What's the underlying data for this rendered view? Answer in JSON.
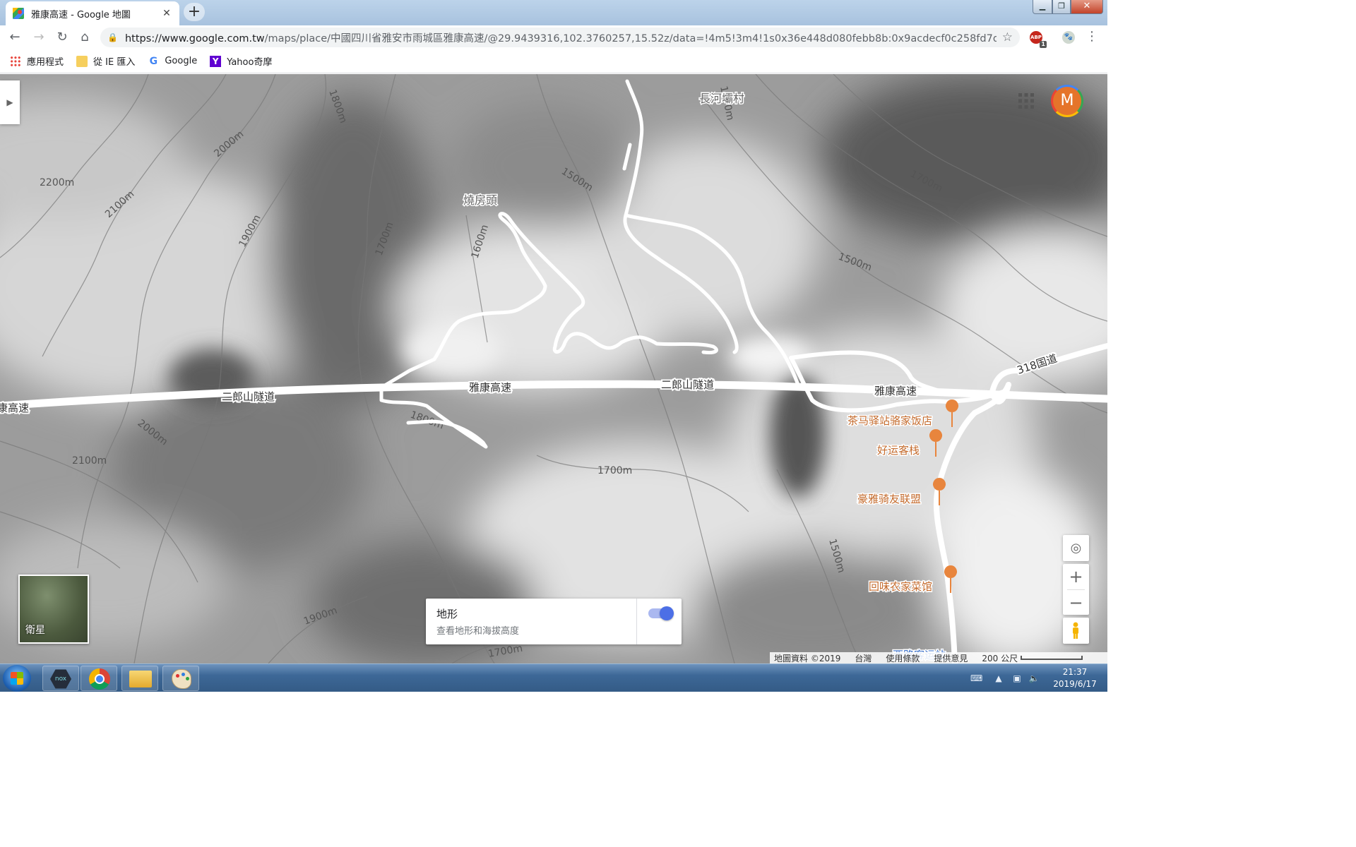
{
  "tab": {
    "title": "雅康高速 - Google 地圖",
    "close": "✕",
    "new_tab": "+"
  },
  "window_controls": {
    "minimize": "▁",
    "maximize": "❐",
    "close": "✕"
  },
  "toolbar": {
    "back": "←",
    "forward": "→",
    "reload": "↻",
    "home": "⌂",
    "url_domain": "https://www.google.com.tw",
    "url_path": "/maps/place/中國四川省雅安市雨城區雅康高速/@29.9439316,102.3760257,15.52z/data=!4m5!3m4!1s0x36e448d080febb8b:0x9acdecf0c258fd7d!8m2!3d2...",
    "abp_label": "ABP",
    "abp_count": "1",
    "menu": "⋮"
  },
  "bookmarks": [
    {
      "label": "應用程式",
      "icon": "apps-grid-icon"
    },
    {
      "label": "從 IE 匯入",
      "icon": "folder-icon"
    },
    {
      "label": "Google",
      "icon": "google-g-icon"
    },
    {
      "label": "Yahoo奇摩",
      "icon": "yahoo-y-icon"
    }
  ],
  "map": {
    "contour_labels": [
      "1800m",
      "2000m",
      "2200m",
      "2100m",
      "1900m",
      "1700m",
      "1600m",
      "1500m",
      "1600m",
      "1700m",
      "1500m",
      "2000m",
      "2100m",
      "1800m",
      "1700m",
      "1500m",
      "1900m",
      "1700m"
    ],
    "road_labels": [
      "康高速",
      "二郎山隧道",
      "雅康高速",
      "二郎山隧道",
      "雅康高速",
      "318国道"
    ],
    "place_labels": [
      "長河壩村",
      "燒房頭"
    ],
    "pois": [
      "茶马驿站骆家饭店",
      "好运客栈",
      "豪雅骑友联盟",
      "回味农家菜馆",
      "西路客运站"
    ]
  },
  "controls": {
    "side_toggle": "▶",
    "avatar_letter": "M",
    "satellite_label": "衛星",
    "terrain_title": "地形",
    "terrain_desc": "查看地形和海拔高度",
    "terrain_on": true,
    "locate": "◎",
    "zoom_in": "+",
    "zoom_out": "−"
  },
  "attribution": {
    "data": "地圖資料 ©2019",
    "region": "台灣",
    "terms": "使用條款",
    "feedback": "提供意見",
    "scale": "200 公尺"
  },
  "taskbar": {
    "nox_label": "nox",
    "time": "21:37",
    "date": "2019/6/17"
  },
  "colors": {
    "poi": "#e8853d",
    "terrain_toggle": "#4c6fe6",
    "avatar": "#e5742a"
  }
}
